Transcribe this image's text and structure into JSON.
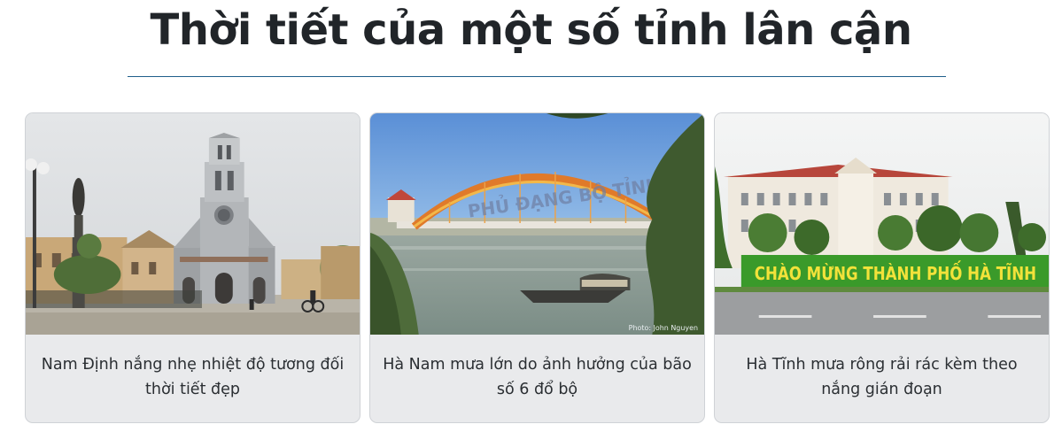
{
  "section": {
    "title": "Thời tiết của một số tỉnh lân cận"
  },
  "cards": [
    {
      "image": "nam-dinh-cathedral-photo",
      "caption": "Nam Định nắng nhẹ nhiệt độ tương đối thời tiết đẹp"
    },
    {
      "image": "ha-nam-bridge-river-photo",
      "caption": "Hà Nam mưa lớn do ảnh hưởng của bão số 6 đổ bộ",
      "bridge_text": "PHỦ ĐẠNG BỘ TỈNH",
      "photo_credit": "Photo: John Nguyen"
    },
    {
      "image": "ha-tinh-welcome-sign-photo",
      "caption": "Hà Tĩnh mưa rông rải rác kèm theo nắng gián đoạn",
      "sign_text": "CHÀO MỪNG THÀNH PHỐ HÀ TĨNH"
    }
  ],
  "colors": {
    "divider": "#1f5f8b",
    "card_background": "#e9eaec",
    "sign_green": "#3a9a2a",
    "sign_letters": "#f2e23a"
  }
}
